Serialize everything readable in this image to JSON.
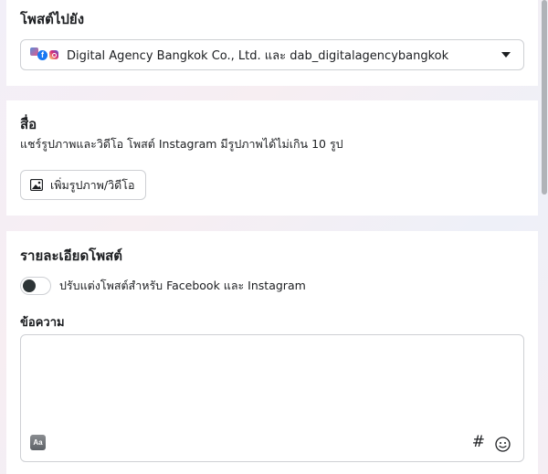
{
  "target": {
    "title": "โพสต์ไปยัง",
    "account": "Digital Agency Bangkok Co., Ltd. และ dab_digitalagencybangkok",
    "icons": [
      "facebook-icon",
      "instagram-icon"
    ]
  },
  "media": {
    "title": "สื่อ",
    "subtitle": "แชร์รูปภาพและวิดีโอ โพสต์ Instagram มีรูปภาพได้ไม่เกิน 10 รูป",
    "add_button": "เพิ่มรูปภาพ/วิดีโอ"
  },
  "details": {
    "title": "รายละเอียดโพสต์",
    "customize_toggle": "ปรับแต่งโพสต์สำหรับ Facebook และ Instagram",
    "toggle_on": false,
    "message_label": "ข้อความ",
    "message_value": "",
    "aa_icon_text": "Aa",
    "hashtag_symbol": "#"
  },
  "colors": {
    "facebook": "#1877f2",
    "border": "#ced0d4",
    "text": "#1c1e21"
  }
}
